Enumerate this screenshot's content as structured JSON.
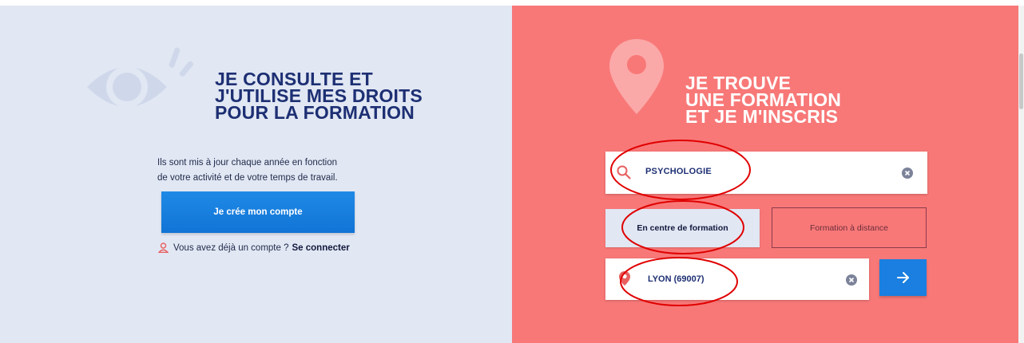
{
  "left_panel": {
    "heading_lines": [
      "JE CONSULTE ET",
      "J'UTILISE MES DROITS",
      "POUR LA FORMATION"
    ],
    "description_lines": [
      "Ils sont mis à jour chaque année en fonction",
      "de votre activité et de votre temps de travail."
    ],
    "create_account_label": "Je crée mon compte",
    "login_prompt": "Vous avez déjà un compte ?",
    "login_link": "Se connecter"
  },
  "right_panel": {
    "heading_lines": [
      "JE TROUVE",
      "UNE FORMATION",
      "ET JE M'INSCRIS"
    ],
    "search_value": "PSYCHOLOGIE",
    "tab_centre_label": "En centre de formation",
    "tab_distance_label": "Formation à distance",
    "location_value": "LYON (69007)"
  },
  "colors": {
    "left_bg": "#e1e7f3",
    "right_bg": "#f87878",
    "navy": "#1d2f73",
    "primary_blue": "#1a7fe0",
    "annotation_red": "#e00000"
  },
  "icons": [
    "eye-icon",
    "location-pin-icon",
    "user-icon",
    "search-icon",
    "clear-icon",
    "arrow-right-icon"
  ]
}
